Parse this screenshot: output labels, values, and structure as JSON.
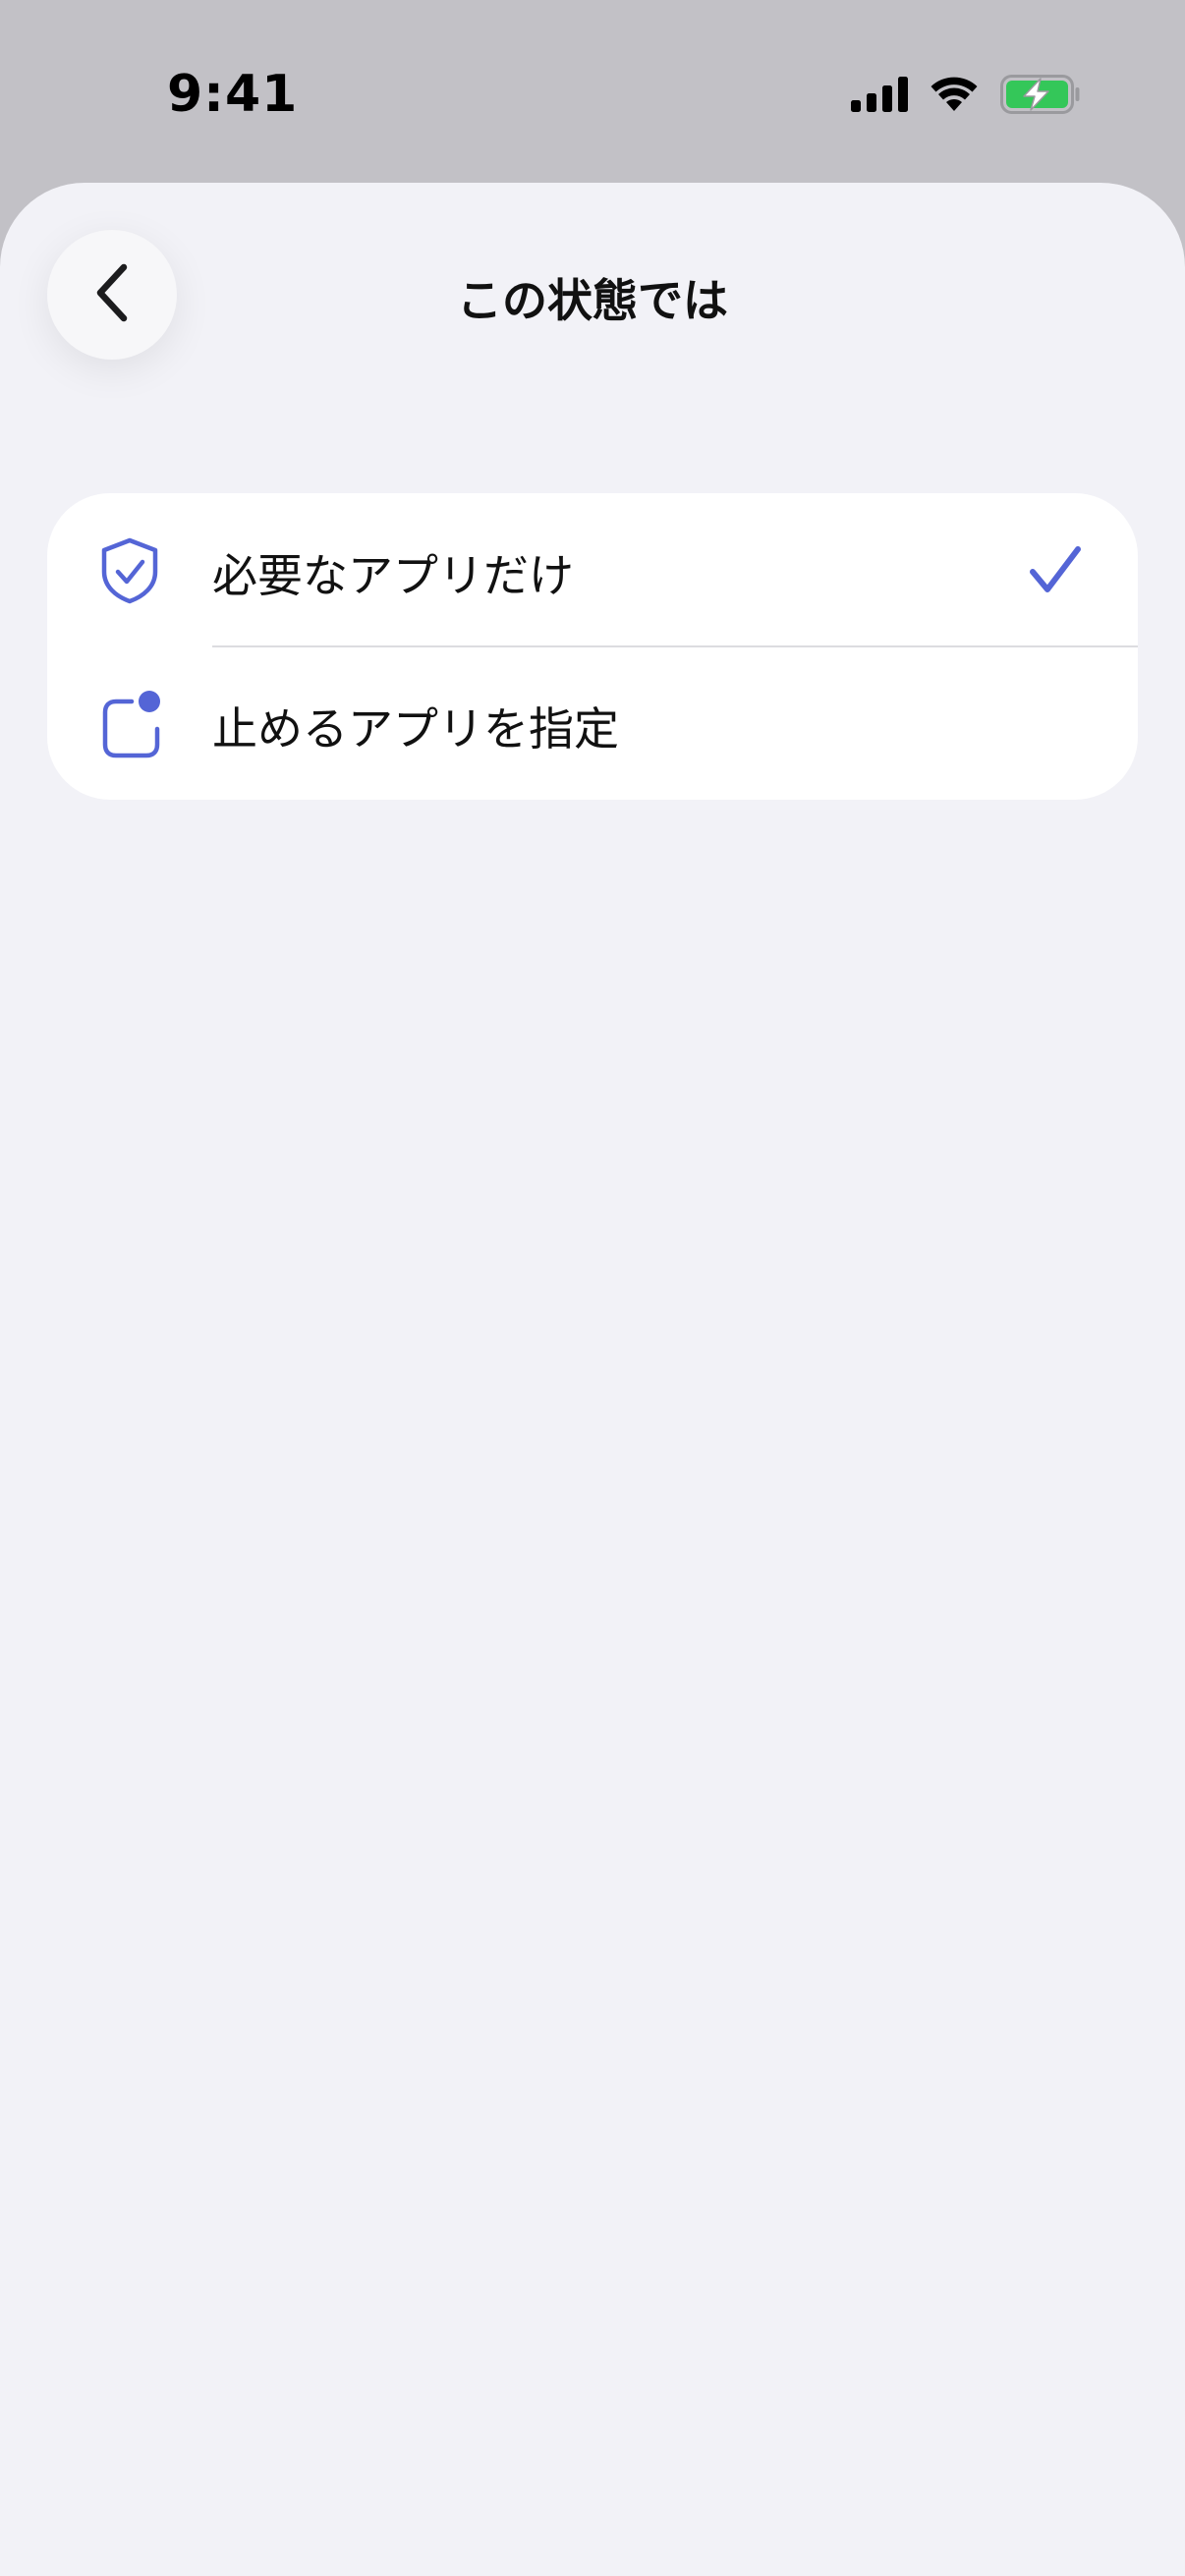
{
  "status_bar": {
    "time": "9:41",
    "icons": [
      "cellular-signal-icon",
      "wifi-icon",
      "battery-charging-icon"
    ]
  },
  "nav": {
    "back_icon": "chevron-left-icon",
    "title": "この状態では"
  },
  "options": [
    {
      "label": "必要なアプリだけ",
      "icon": "shield-check-icon",
      "selected": true
    },
    {
      "label": "止めるアプリを指定",
      "icon": "app-badge-icon",
      "selected": false
    }
  ],
  "colors": {
    "accent": "#5465d6",
    "sheet_background": "#f2f2f7",
    "card_background": "#ffffff",
    "battery_green": "#34c759"
  }
}
